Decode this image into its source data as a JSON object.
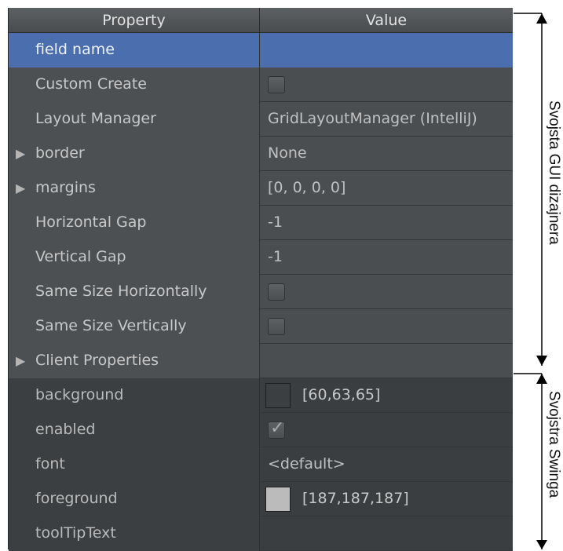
{
  "header": {
    "property": "Property",
    "value": "Value"
  },
  "gui_rows": [
    {
      "label": "field name",
      "expander": false,
      "value_type": "text",
      "value": "",
      "selected": true
    },
    {
      "label": "Custom Create",
      "expander": false,
      "value_type": "checkbox",
      "checked": false
    },
    {
      "label": "Layout Manager",
      "expander": false,
      "value_type": "text",
      "value": "GridLayoutManager (IntelliJ)"
    },
    {
      "label": "border",
      "expander": true,
      "value_type": "text",
      "value": "None"
    },
    {
      "label": "margins",
      "expander": true,
      "value_type": "text",
      "value": "[0, 0, 0, 0]"
    },
    {
      "label": "Horizontal Gap",
      "expander": false,
      "value_type": "text",
      "value": "-1"
    },
    {
      "label": "Vertical Gap",
      "expander": false,
      "value_type": "text",
      "value": "-1"
    },
    {
      "label": "Same Size Horizontally",
      "expander": false,
      "value_type": "checkbox",
      "checked": false
    },
    {
      "label": "Same Size Vertically",
      "expander": false,
      "value_type": "checkbox",
      "checked": false
    },
    {
      "label": "Client Properties",
      "expander": true,
      "value_type": "text",
      "value": ""
    }
  ],
  "swing_rows": [
    {
      "label": "background",
      "value_type": "color",
      "color": "#3c3f41",
      "value": "[60,63,65]"
    },
    {
      "label": "enabled",
      "value_type": "checkbox",
      "checked": true
    },
    {
      "label": "font",
      "value_type": "text",
      "value": "<default>"
    },
    {
      "label": "foreground",
      "value_type": "color",
      "color": "#bbbbbb",
      "value": "[187,187,187]"
    },
    {
      "label": "toolTipText",
      "value_type": "text",
      "value": ""
    }
  ],
  "annotations": {
    "gui": "Svojsta GUI dizajnera",
    "swing": "Svojstra Swinga"
  },
  "icons": {
    "expander": "triangle-right-icon",
    "check": "checkmark-icon"
  },
  "colors": {
    "selection": "#4b6eaf",
    "panel": "#3c3f41"
  }
}
